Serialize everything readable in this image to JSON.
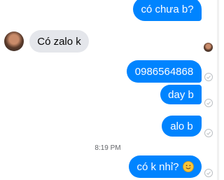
{
  "messages": [
    {
      "text": "có chưa b?"
    },
    {
      "text": "Có zalo k"
    },
    {
      "text": "0986564868"
    },
    {
      "text": "day b"
    },
    {
      "text": "alo b"
    },
    {
      "text": "có k nhỉ?"
    }
  ],
  "timestamp": "8:19 PM",
  "icons": {
    "emoji": "slightly-smiling-face-icon",
    "status": "sent-check-icon"
  },
  "colors": {
    "outgoing_bubble": "#0084ff",
    "incoming_bubble": "#e4e6eb",
    "status_ring": "#bcc0c4"
  }
}
